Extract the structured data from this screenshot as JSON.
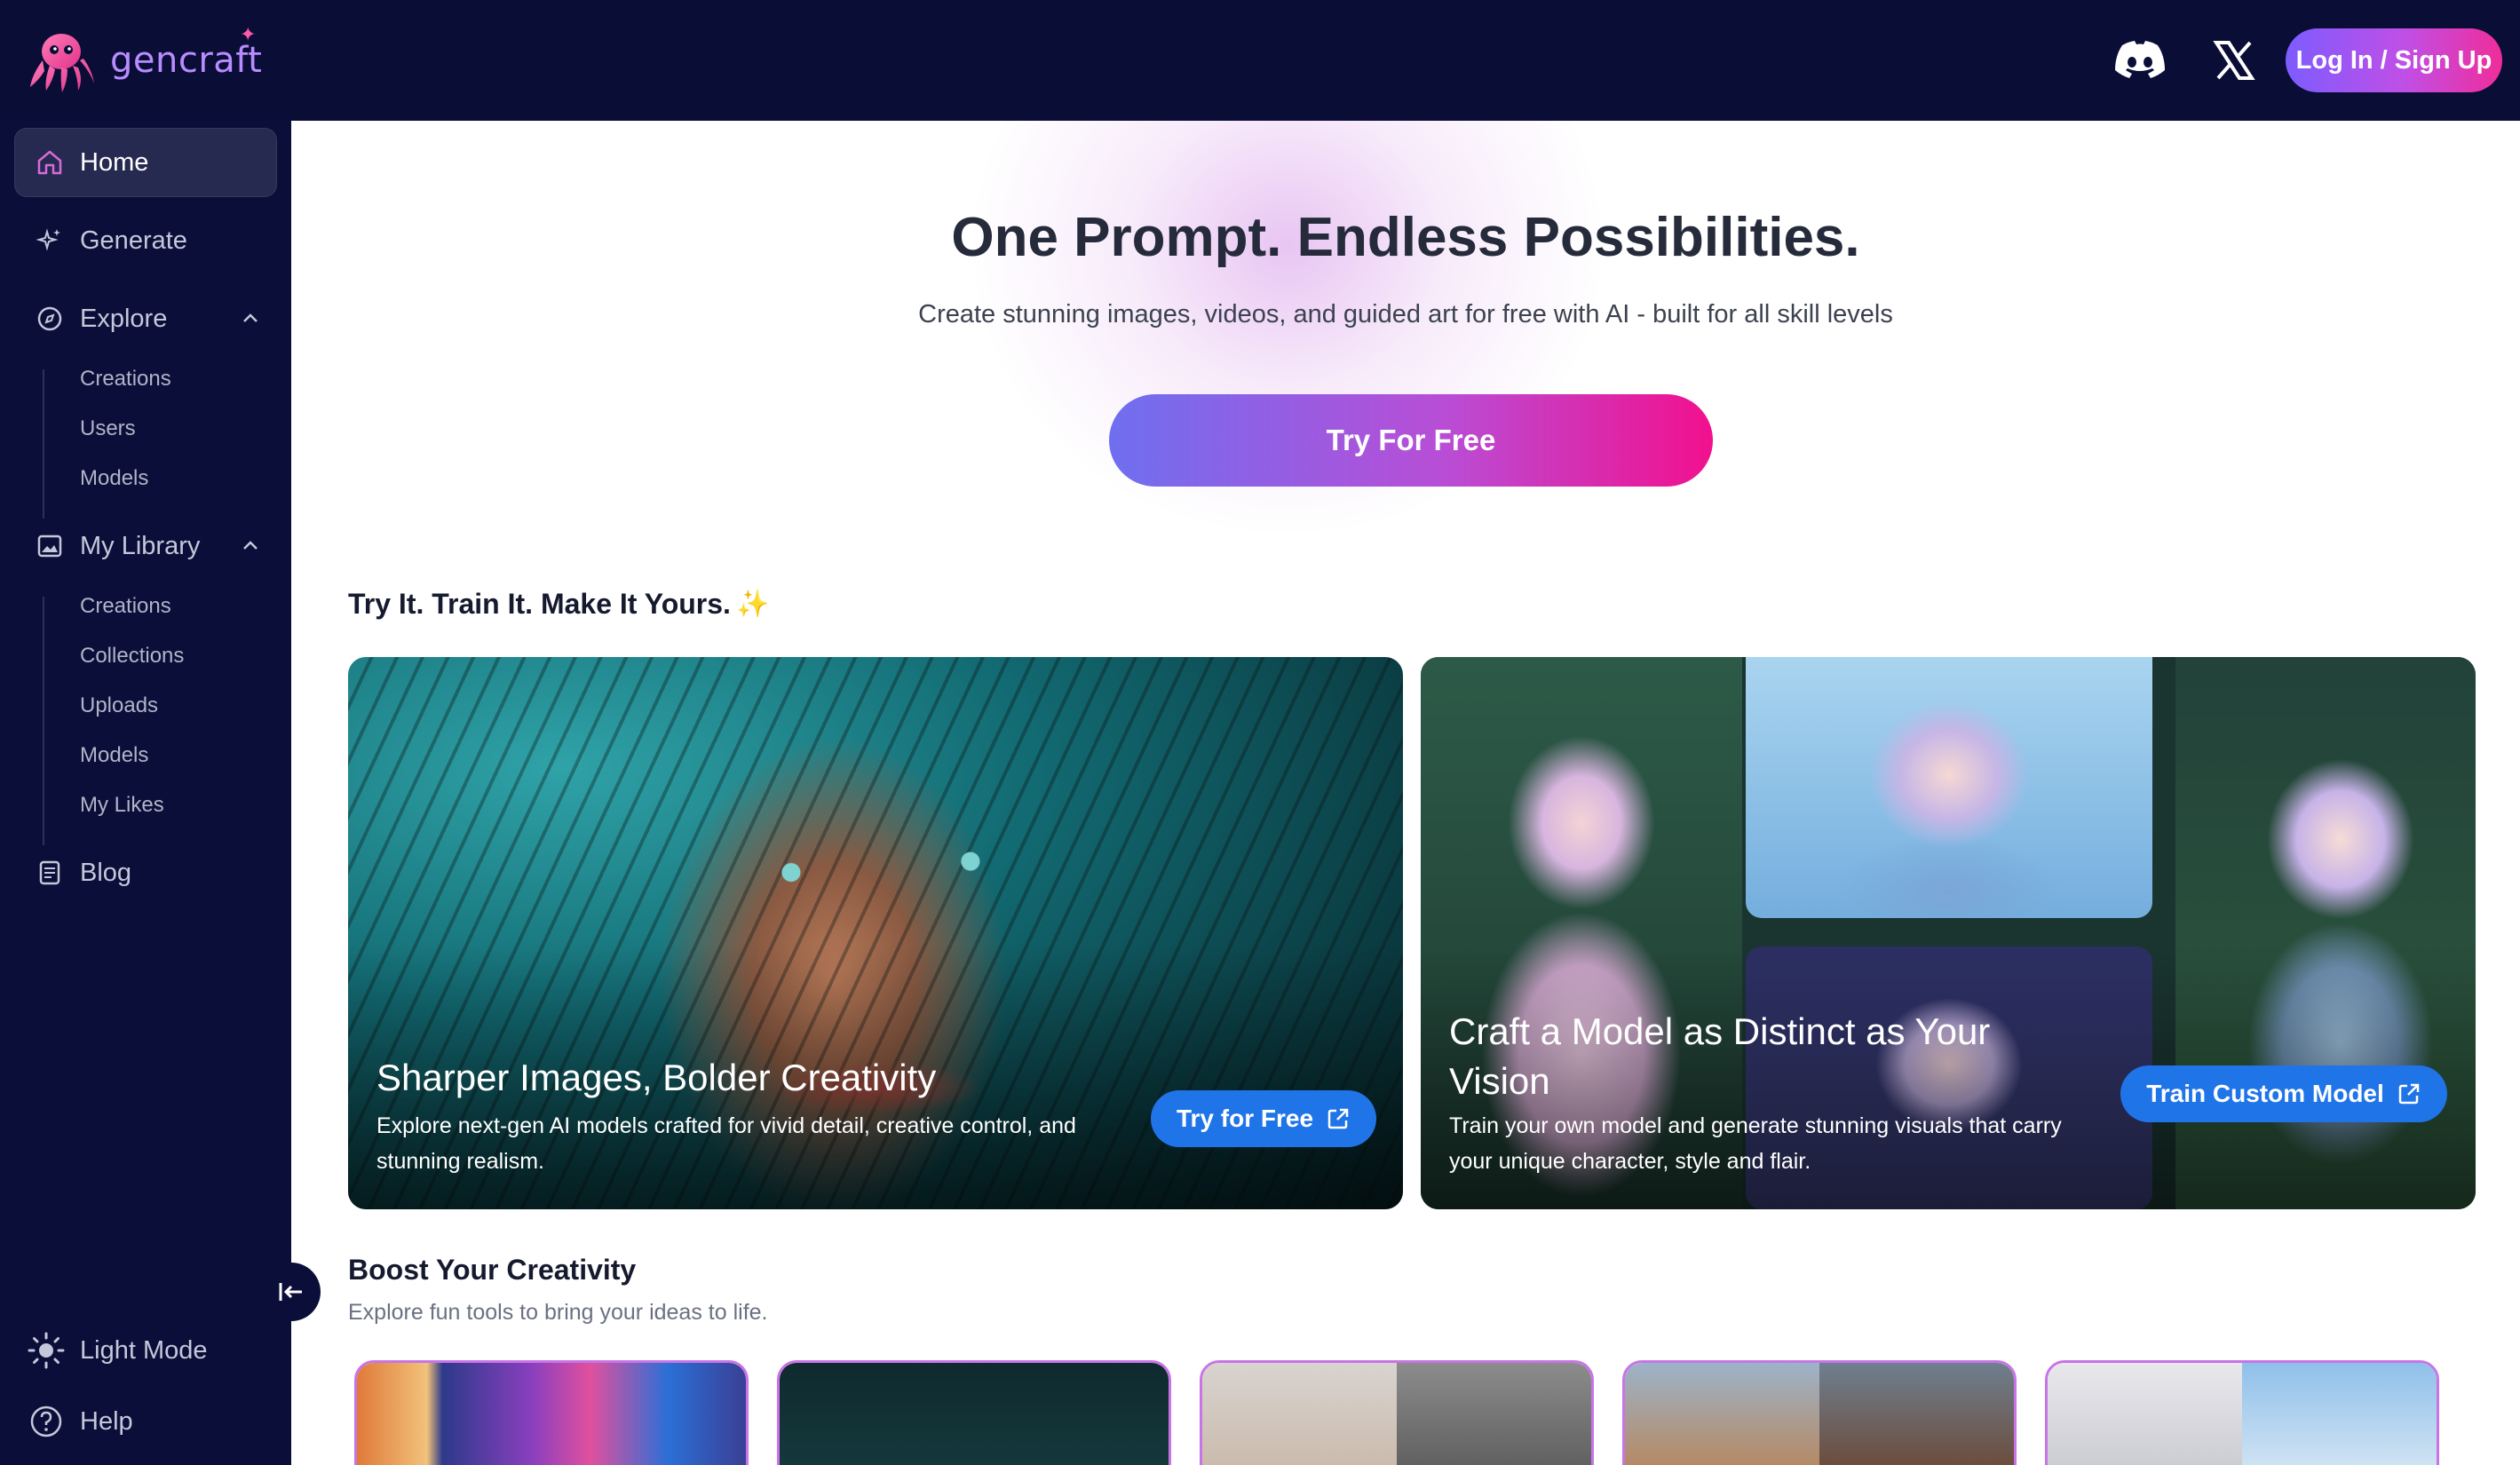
{
  "brand": {
    "name": "gencraft"
  },
  "header": {
    "login_label": "Log In / Sign Up"
  },
  "sidebar": {
    "home": "Home",
    "generate": "Generate",
    "explore": {
      "label": "Explore",
      "items": [
        "Creations",
        "Users",
        "Models"
      ]
    },
    "library": {
      "label": "My Library",
      "items": [
        "Creations",
        "Collections",
        "Uploads",
        "Models",
        "My Likes"
      ]
    },
    "blog": "Blog",
    "light_mode": "Light Mode",
    "help": "Help"
  },
  "hero": {
    "title": "One Prompt. Endless Possibilities.",
    "subtitle": "Create stunning images, videos, and guided art for free with AI - built for all skill levels",
    "cta": "Try For Free"
  },
  "section1": {
    "title": "Try It. Train It. Make It Yours."
  },
  "cards": [
    {
      "title": "Sharper Images, Bolder Creativity",
      "desc_line1": "Explore next-gen AI models crafted for vivid detail, creative control, and",
      "desc_line2": "stunning realism.",
      "button": "Try for Free"
    },
    {
      "title_line1": "Craft a Model as Distinct as Your",
      "title_line2": "Vision",
      "desc_line1": "Train your own model and generate stunning visuals that carry",
      "desc_line2": "your unique character, style and flair.",
      "button": "Train Custom Model"
    }
  ],
  "section2": {
    "title": "Boost Your Creativity",
    "subtitle": "Explore fun tools to bring your ideas to life."
  },
  "colors": {
    "topbar": "#0a0d36",
    "sidebar": "#0b0e38",
    "accent_blue": "#1f74e8",
    "cta_start": "#6f6ff0",
    "cta_end": "#f2108e"
  }
}
